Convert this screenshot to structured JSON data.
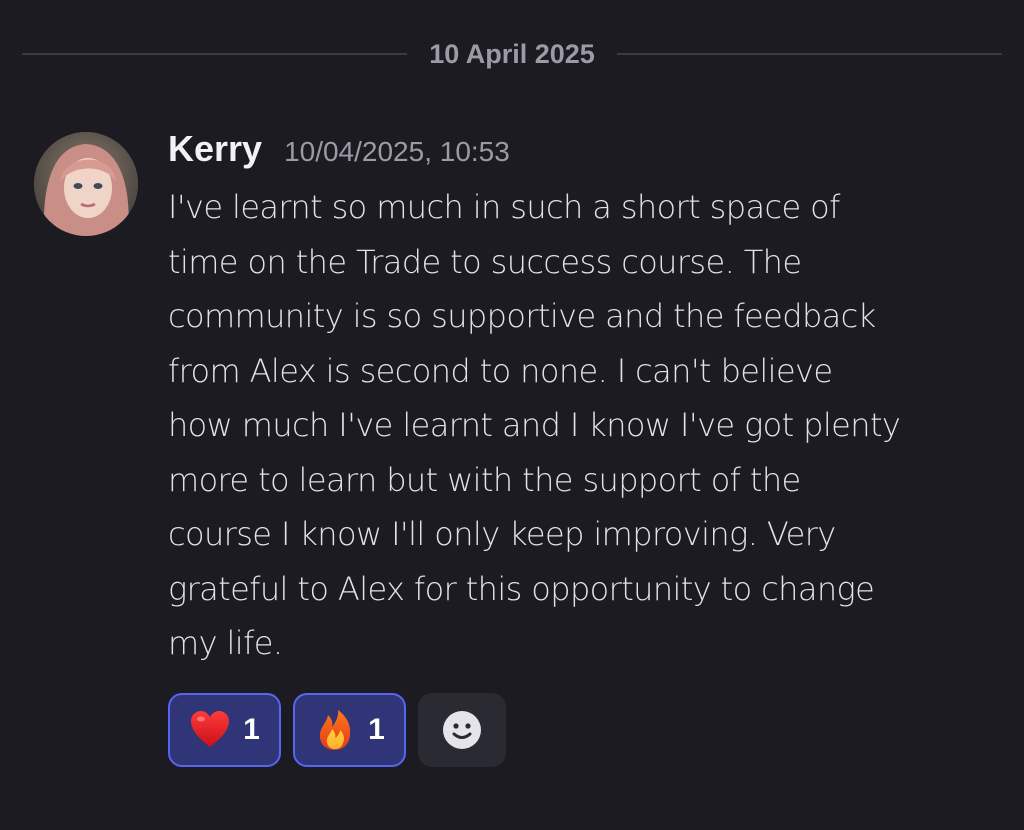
{
  "divider": {
    "date": "10 April 2025"
  },
  "message": {
    "username": "Kerry",
    "timestamp": "10/04/2025, 10:53",
    "lines": [
      "I've learnt so much in such a short space of",
      "time on the Trade to success course. The",
      "community is so supportive and the feedback",
      "from Alex is second to none. I can't believe",
      "how much I've learnt and I know I've got plenty",
      "more to learn but with the support of the",
      "course I know I'll only keep improving. Very",
      "grateful to Alex for this opportunity to change",
      "my life."
    ]
  },
  "reactions": [
    {
      "emoji": "heart-icon",
      "count": "1"
    },
    {
      "emoji": "fire-icon",
      "count": "1"
    }
  ],
  "add_reaction": {
    "icon": "smiley-add-reaction-icon"
  },
  "colors": {
    "background": "#1b1b21",
    "reaction_active_bg": "#2f3576",
    "reaction_active_border": "#5865f2",
    "muted_text": "#9b9ba5"
  }
}
